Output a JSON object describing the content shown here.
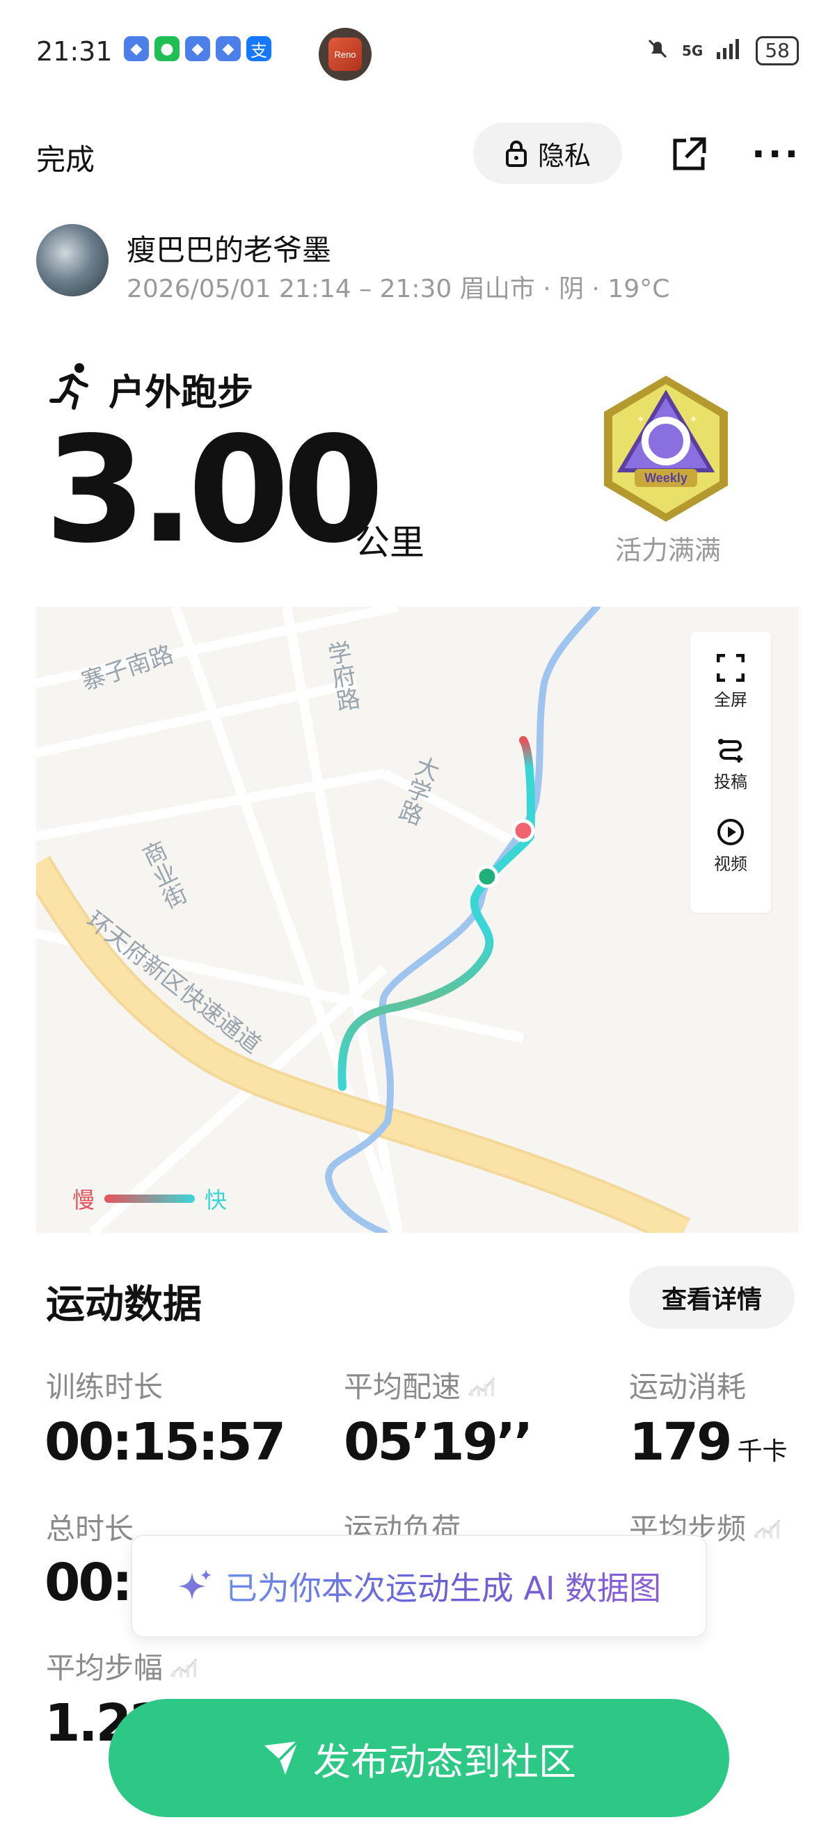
{
  "status_bar": {
    "time": "21:31",
    "network": "5G",
    "battery": "58",
    "app_icon_label": "Reno"
  },
  "top_bar": {
    "done_label": "完成",
    "privacy_label": "隐私"
  },
  "user": {
    "name": "瘦巴巴的老爷墨",
    "meta": "2026/05/01 21:14 – 21:30 眉山市 · 阴 · 19°C"
  },
  "activity": {
    "type": "户外跑步",
    "distance": "3.00",
    "unit": "公里",
    "badge_text": "Weekly",
    "badge_label": "活力满满"
  },
  "map": {
    "road_labels": [
      "寨子南路",
      "学府路",
      "大学路",
      "商业街",
      "环天府新区快速通道"
    ],
    "tools": {
      "fullscreen": "全屏",
      "submit": "投稿",
      "video": "视频"
    },
    "legend": {
      "slow": "慢",
      "fast": "快"
    }
  },
  "stats_section": {
    "title": "运动数据",
    "detail_button": "查看详情",
    "items": [
      {
        "label": "训练时长",
        "value": "00:15:57",
        "unit": ""
      },
      {
        "label": "平均配速",
        "value": "05’19’’",
        "unit": ""
      },
      {
        "label": "运动消耗",
        "value": "179",
        "unit": "千卡"
      },
      {
        "label": "总时长",
        "value": "00:1",
        "unit": ""
      },
      {
        "label": "运动负荷",
        "value": "",
        "unit": ""
      },
      {
        "label": "平均步频",
        "value": "",
        "unit": ""
      },
      {
        "label": "平均步幅",
        "value": "1.22",
        "unit": ""
      }
    ]
  },
  "ai_banner": {
    "text": "已为你本次运动生成 AI 数据图"
  },
  "publish_button": {
    "label": "发布动态到社区"
  },
  "colors": {
    "accent_green": "#2dc886",
    "route_fast": "#3ad6d6",
    "route_slow": "#e4545a",
    "river": "#9fc4ee",
    "highway": "#fbe2a6"
  }
}
